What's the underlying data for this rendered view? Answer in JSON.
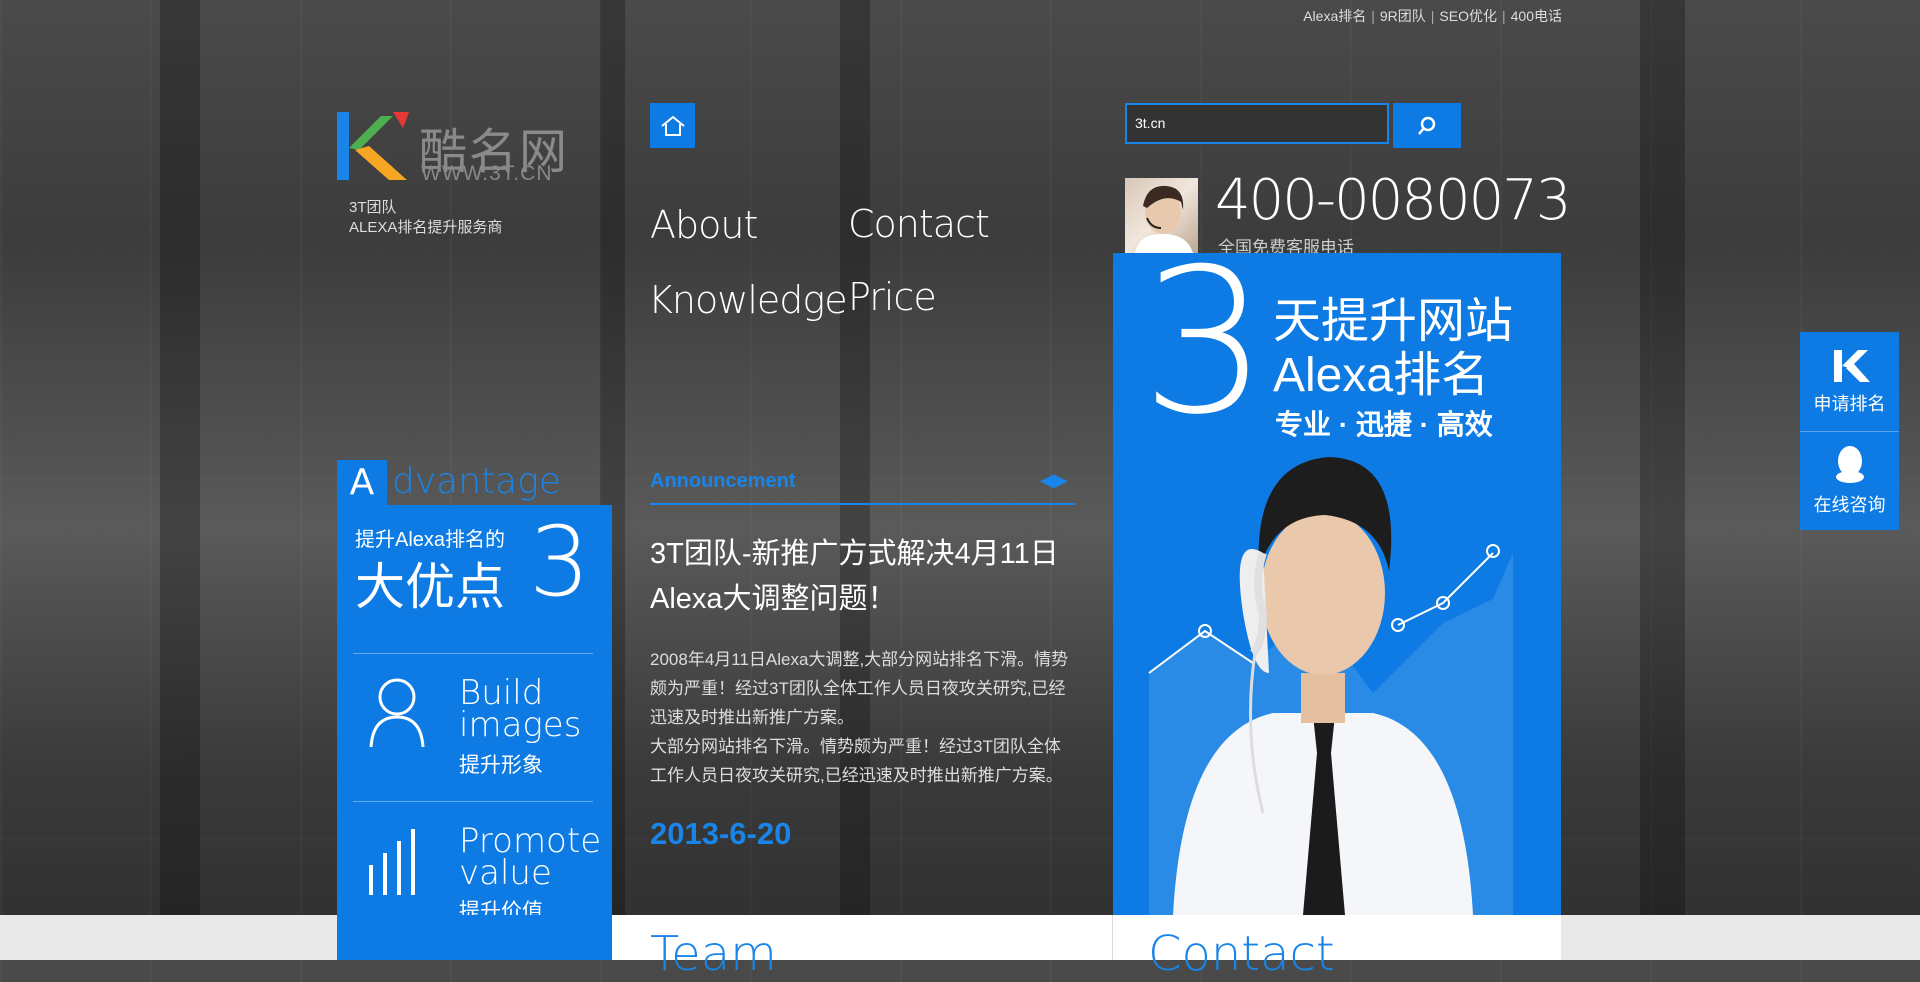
{
  "top_links": [
    "Alexa排名",
    "9R团队",
    "SEO优化",
    "400电话"
  ],
  "top_links_separator": "|",
  "logo": {
    "brand": "酷名网",
    "url": "WWW.3T.CN",
    "tagline_line1": "3T团队",
    "tagline_line2": "ALEXA排名提升服务商"
  },
  "nav": {
    "home_icon": "home-icon",
    "items": [
      "About",
      "Contact",
      "Knowledge",
      "Price"
    ]
  },
  "search": {
    "value": "3t.cn",
    "icon": "search-icon"
  },
  "hotline": {
    "number": "400-0080073",
    "label": "全国免费客服电话"
  },
  "banner": {
    "number": "3",
    "line1": "天提升网站",
    "line2": "Alexa排名",
    "slogan": "专业 · 迅捷 · 高效"
  },
  "advantage": {
    "tab_letter": "A",
    "tab_rest": "dvantage",
    "small_title": "提升Alexa排名的",
    "big_title": "大优点",
    "count": "3",
    "items": [
      {
        "en_line1": "Build",
        "en_line2": "images",
        "cn": "提升形象",
        "icon": "person-icon"
      },
      {
        "en_line1": "Promote",
        "en_line2": "value",
        "cn": "提升价值",
        "icon": "bars-icon"
      }
    ]
  },
  "announcement": {
    "title": "Announcement",
    "headline": "3T团队-新推广方式解决4月11日Alexa大调整问题！",
    "body_para1": "2008年4月11日Alexa大调整,大部分网站排名下滑。情势颇为严重！经过3T团队全体工作人员日夜攻关研究,已经迅速及时推出新推广方案。",
    "body_para2": "大部分网站排名下滑。情势颇为严重！经过3T团队全体工作人员日夜攻关研究,已经迅速及时推出新推广方案。",
    "date": "2013-6-20",
    "prev": "◀",
    "next": "▶"
  },
  "bottom": {
    "team": "Team",
    "contact": "Contact"
  },
  "side_float": [
    {
      "label": "申请排名",
      "icon": "k-logo-icon"
    },
    {
      "label": "在线咨询",
      "icon": "qq-icon"
    }
  ],
  "colors": {
    "accent": "#0d7be3",
    "accent_text": "#1a85e8",
    "background": "#3c3c3c"
  }
}
